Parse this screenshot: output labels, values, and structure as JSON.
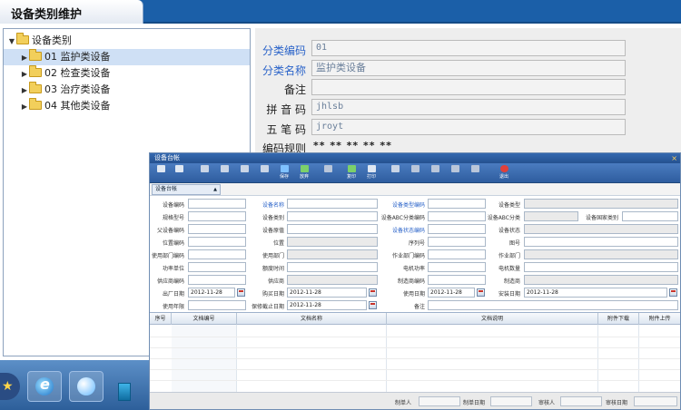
{
  "page": {
    "tab_title": "设备类别维护"
  },
  "tree": {
    "root": "设备类别",
    "items": [
      {
        "label": "01 监护类设备",
        "selected": true
      },
      {
        "label": "02 检查类设备",
        "selected": false
      },
      {
        "label": "03 治疗类设备",
        "selected": false
      },
      {
        "label": "04 其他类设备",
        "selected": false
      }
    ]
  },
  "form": {
    "code": {
      "label": "分类编码",
      "value": "01"
    },
    "name": {
      "label": "分类名称",
      "value": "监护类设备"
    },
    "note": {
      "label": "备注",
      "value": ""
    },
    "pinyin": {
      "label": "拼 音 码",
      "value": "jhlsb"
    },
    "wubi": {
      "label": "五 笔 码",
      "value": "jroyt"
    },
    "rule": {
      "label": "编码规则",
      "value": "** ** ** ** **"
    }
  },
  "dialog": {
    "title": "设备台帐",
    "close_glyph": "×",
    "toolbar": [
      {
        "icon": "first-icon",
        "label": ""
      },
      {
        "icon": "next-icon",
        "label": ""
      },
      {
        "icon": "edit-icon",
        "label": ""
      },
      {
        "icon": "check-icon",
        "label": ""
      },
      {
        "icon": "doc-icon",
        "label": ""
      },
      {
        "icon": "import-icon",
        "label": ""
      },
      {
        "icon": "save-icon",
        "label": "保存"
      },
      {
        "icon": "cancel-icon",
        "label": "放弃"
      },
      {
        "icon": "tools-icon",
        "label": ""
      },
      {
        "icon": "copy-icon",
        "label": "复印"
      },
      {
        "icon": "print-icon",
        "label": "打印"
      },
      {
        "icon": "find-icon",
        "label": ""
      },
      {
        "icon": "prev-icon",
        "label": ""
      },
      {
        "icon": "up-icon",
        "label": ""
      },
      {
        "icon": "down-icon",
        "label": ""
      },
      {
        "icon": "last-icon",
        "label": ""
      },
      {
        "icon": "exit-icon",
        "label": "退出"
      }
    ],
    "subtab": "设备台帐",
    "fields": {
      "equip_code": "设备编码",
      "equip_name": "设备名称",
      "equip_type_code": "设备类型编码",
      "equip_type": "设备类型",
      "model": "规格型号",
      "category": "设备类别",
      "abc_code": "设备ABC分类编码",
      "abc": "设备ABC分类",
      "country_cat": "设备国家类别",
      "parent_code": "父设备编码",
      "orig_value": "设备原值",
      "status_code": "设备状态编码",
      "status": "设备状态",
      "location_code": "位置编码",
      "location": "位置",
      "serial": "序列号",
      "drawing": "图号",
      "use_dept_code": "使用部门编码",
      "use_dept": "使用部门",
      "work_dept_code": "作业部门编码",
      "work_dept": "作业部门",
      "power_unit": "功率单位",
      "rated_time": "额度时间",
      "motor_power": "电机功率",
      "motor_count": "电机数量",
      "supplier_code": "供应商编码",
      "supplier": "供应商",
      "maker_code": "制造商编码",
      "maker": "制造商",
      "factory_date": "出厂日期",
      "purchase_date": "购买日期",
      "use_date": "使用日期",
      "install_date": "安装日期",
      "service_years": "使用年限",
      "warranty_date": "保修截止日期",
      "remark": "备注"
    },
    "dates": {
      "factory": "2012-11-28",
      "purchase": "2012-11-28",
      "use": "2012-11-28",
      "install": "2012-11-28",
      "warranty": "2012-11-28"
    },
    "grid_headers": [
      "序号",
      "文档编号",
      "文档名称",
      "文档说明",
      "附件下载",
      "附件上传"
    ],
    "footer": {
      "maker": "制单人",
      "make_date": "制单日期",
      "auditor": "审核人",
      "audit_date": "审核日期"
    }
  },
  "colors": {
    "accent": "#1b5fa8",
    "label_blue": "#2a63c9",
    "selection": "#cfe0f5"
  }
}
